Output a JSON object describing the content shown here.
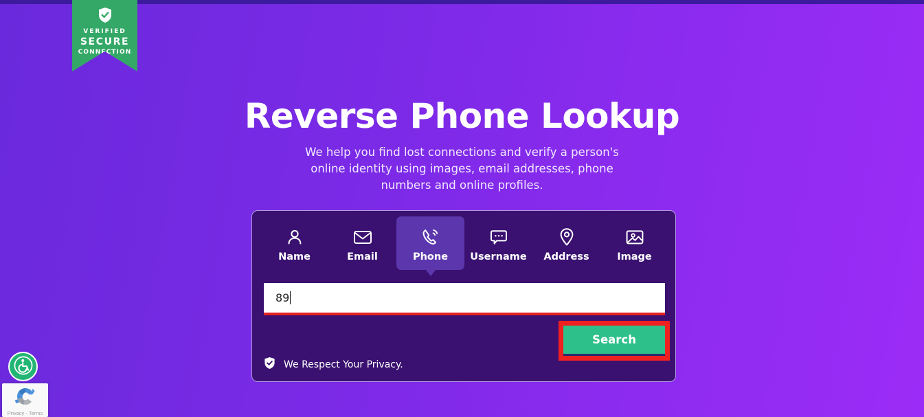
{
  "page": {
    "background_gradient_from": "#6a29dc",
    "background_gradient_to": "#9b2cf7",
    "top_strip_color": "#3d1b9e"
  },
  "trust_badge": {
    "icon": "shield-check-icon",
    "line1": "VERIFIED",
    "line2": "SECURE",
    "line3": "CONNECTION",
    "color": "#34a866"
  },
  "hero": {
    "title": "Reverse Phone Lookup",
    "subtitle": "We help you find lost connections and verify a person's online identity using images, email addresses, phone numbers and online profiles."
  },
  "search_card": {
    "background": "#3a1170",
    "tabs": [
      {
        "label": "Name",
        "icon": "person-icon",
        "active": false
      },
      {
        "label": "Email",
        "icon": "envelope-icon",
        "active": false
      },
      {
        "label": "Phone",
        "icon": "phone-ringing-icon",
        "active": true
      },
      {
        "label": "Username",
        "icon": "speech-bubble-icon",
        "active": false
      },
      {
        "label": "Address",
        "icon": "map-pin-icon",
        "active": false
      },
      {
        "label": "Image",
        "icon": "image-icon",
        "active": false
      }
    ],
    "active_tab_color": "#5b36ad",
    "input": {
      "value": "89",
      "placeholder": "",
      "underline_color": "#e32222",
      "state": "invalid"
    },
    "search_button": {
      "label": "Search",
      "color": "#2ec08a",
      "highlight_color": "#ef2020",
      "highlighted": true
    },
    "privacy": {
      "icon": "shield-check-icon",
      "label": "We Respect Your Privacy."
    }
  },
  "accessibility_widget": {
    "icon": "wheelchair-icon",
    "color": "#22b573"
  },
  "recaptcha": {
    "icon": "recaptcha-logo-icon",
    "text": "Privacy - Terms"
  }
}
